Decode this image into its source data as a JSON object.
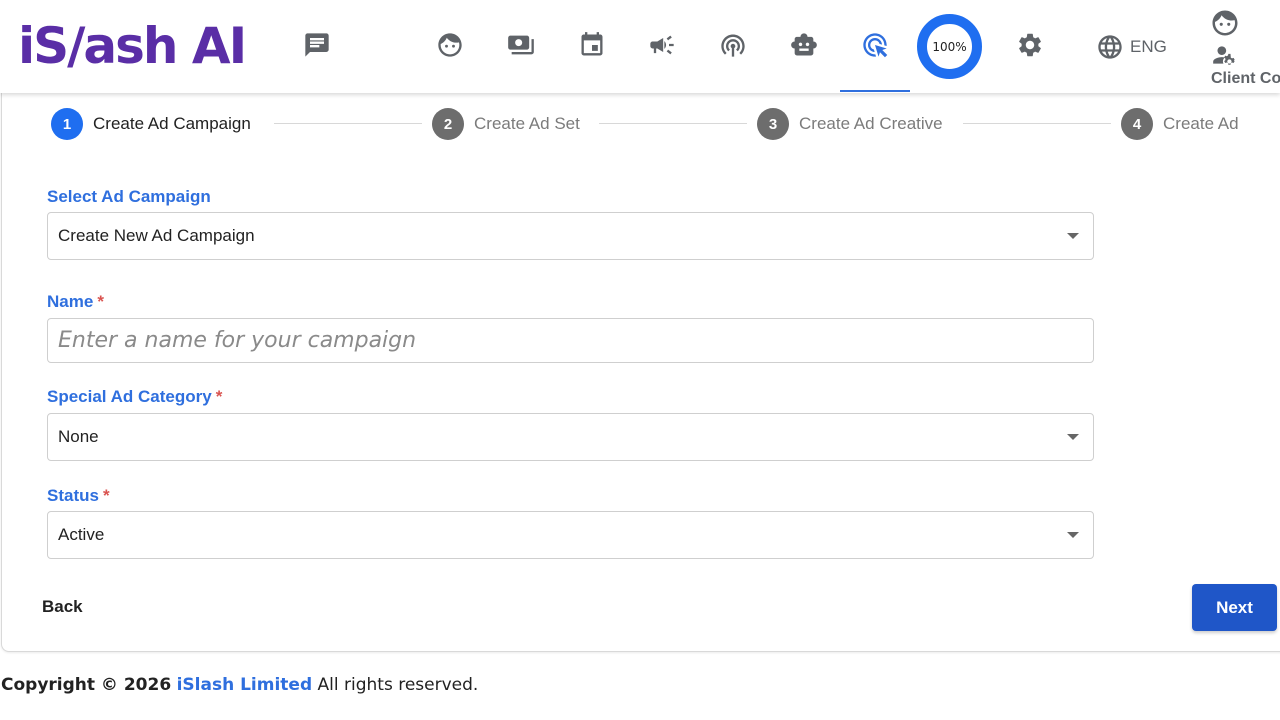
{
  "header": {
    "logo_part1": "iS/",
    "logo_part2": "ash AI",
    "logo_part3": "",
    "progress_label": "100%",
    "language": "ENG",
    "client_label": "Client Co"
  },
  "icons": [
    "chat-icon",
    "face-icon",
    "payments-icon",
    "calendar-icon",
    "campaign-icon",
    "podcast-icon",
    "robot-icon",
    "ads-click-icon",
    "settings-icon",
    "globe-icon"
  ],
  "stepper": [
    {
      "number": "1",
      "label": "Create Ad Campaign",
      "active": true
    },
    {
      "number": "2",
      "label": "Create Ad Set",
      "active": false
    },
    {
      "number": "3",
      "label": "Create Ad Creative",
      "active": false
    },
    {
      "number": "4",
      "label": "Create Ad",
      "active": false
    }
  ],
  "form": {
    "select_campaign_label": "Select Ad Campaign",
    "select_campaign_value": "Create New Ad Campaign",
    "name_label": "Name",
    "name_placeholder": "Enter a name for your campaign",
    "required_mark": "*",
    "special_category_label": "Special Ad Category",
    "special_category_value": "None",
    "status_label": "Status",
    "status_value": "Active"
  },
  "actions": {
    "back_label": "Back",
    "next_label": "Next"
  },
  "footer": {
    "prefix": "Copyright © 2026",
    "company": "iSlash Limited",
    "suffix": "All rights reserved."
  },
  "colors": {
    "accent": "#1f6ef0",
    "label_blue": "#2f6fde",
    "next_button": "#1f56c8",
    "logo_purple": "#5a2ea6",
    "logo_blue": "#4a6ee0"
  }
}
